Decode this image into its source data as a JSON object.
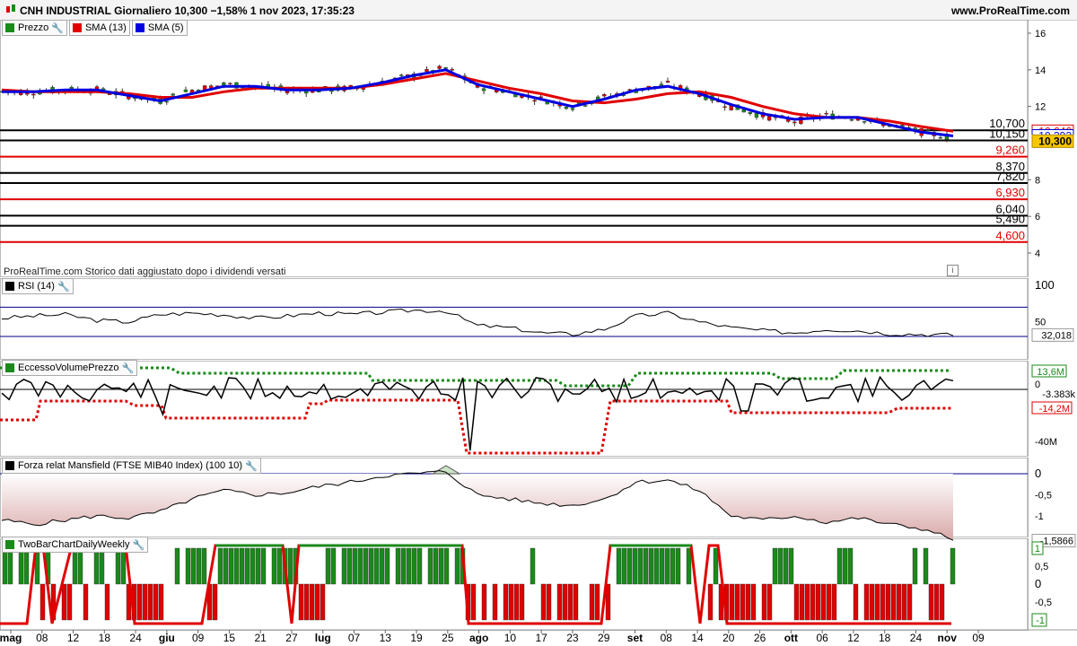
{
  "header": {
    "title": "CNH INDUSTRIAL Giornaliero 10,300 −1,58% 1 nov 2023, 17:35:23",
    "site": "www.ProRealTime.com"
  },
  "price_panel": {
    "legend": [
      {
        "label": "Prezzo",
        "color": "#1a8a1a",
        "icon": "candle-icon"
      },
      {
        "label": "SMA (13)",
        "color": "#e00000"
      },
      {
        "label": "SMA (5)",
        "color": "#0000e0"
      }
    ],
    "note": "ProRealTime.com Storico dati aggiustato dopo i dividendi versati",
    "axis_ticks": [
      "16",
      "14",
      "12",
      "8",
      "6",
      "4"
    ],
    "levels": [
      {
        "label": "10,700",
        "value": 10.7,
        "color": "#000000"
      },
      {
        "label": "10,150",
        "value": 10.15,
        "color": "#000000"
      },
      {
        "label": "9,260",
        "value": 9.26,
        "color": "#e00000"
      },
      {
        "label": "8,370",
        "value": 8.37,
        "color": "#000000"
      },
      {
        "label": "7,820",
        "value": 7.82,
        "color": "#000000"
      },
      {
        "label": "6,930",
        "value": 6.93,
        "color": "#e00000"
      },
      {
        "label": "6,040",
        "value": 6.04,
        "color": "#000000"
      },
      {
        "label": "5,490",
        "value": 5.49,
        "color": "#000000"
      },
      {
        "label": "4,600",
        "value": 4.6,
        "color": "#e00000"
      }
    ],
    "last_price": "10,300",
    "sma13_value": "10,646",
    "sma5_value": "10,392"
  },
  "rsi_panel": {
    "legend": "RSI (14)",
    "axis_ticks": [
      "100",
      "50"
    ],
    "value": "32,018"
  },
  "volume_panel": {
    "legend": "EccessoVolumePrezzo",
    "axis_ticks": [
      "0",
      "-40M"
    ],
    "upper_value": "13,6M",
    "value": "-3.383k",
    "lower_value": "-14,2M"
  },
  "mansfield_panel": {
    "legend": "Forza relat Mansfield (FTSE MIB40 Index) (100 10)",
    "axis_ticks": [
      "0",
      "-0,5",
      "-1"
    ],
    "value": "-1,5866"
  },
  "twobar_panel": {
    "legend": "TwoBarChartDailyWeekly",
    "axis_ticks": [
      "0,5",
      "0",
      "-0,5"
    ],
    "upper_value": "1",
    "lower_value": "-1"
  },
  "x_axis": {
    "labels": [
      "mag",
      "08",
      "12",
      "18",
      "24",
      "giu",
      "09",
      "15",
      "21",
      "27",
      "lug",
      "07",
      "13",
      "19",
      "25",
      "ago",
      "10",
      "17",
      "23",
      "29",
      "set",
      "08",
      "14",
      "20",
      "26",
      "ott",
      "06",
      "12",
      "18",
      "24",
      "nov",
      "09"
    ]
  },
  "colors": {
    "up": "#1a8a1a",
    "down": "#e00000",
    "sma13": "#e00000",
    "sma5": "#0000e0",
    "highlight": "#f7c600"
  },
  "chart_data": {
    "type": "line",
    "title": "CNH INDUSTRIAL Giornaliero 10,300 −1,58% 1 nov 2023, 17:35:23",
    "x": [
      "mag",
      "08",
      "12",
      "18",
      "24",
      "giu",
      "09",
      "15",
      "21",
      "27",
      "lug",
      "07",
      "13",
      "19",
      "25",
      "ago",
      "10",
      "17",
      "23",
      "29",
      "set",
      "08",
      "14",
      "20",
      "26",
      "ott",
      "06",
      "12",
      "18",
      "24",
      "nov"
    ],
    "series": [
      {
        "name": "Prezzo",
        "values": [
          12.8,
          12.8,
          12.9,
          12.9,
          12.6,
          12.3,
          12.9,
          13.2,
          13.1,
          12.9,
          12.9,
          13.0,
          13.3,
          13.7,
          14.1,
          13.1,
          12.8,
          12.4,
          12.0,
          12.5,
          12.9,
          13.2,
          12.7,
          12.0,
          11.5,
          11.2,
          11.5,
          11.4,
          11.0,
          10.6,
          10.3
        ]
      },
      {
        "name": "SMA (13)",
        "values": [
          12.9,
          12.8,
          12.8,
          12.8,
          12.7,
          12.5,
          12.5,
          12.8,
          13.0,
          13.0,
          13.0,
          13.0,
          13.2,
          13.5,
          13.8,
          13.4,
          13.0,
          12.7,
          12.3,
          12.2,
          12.4,
          12.7,
          12.8,
          12.5,
          12.0,
          11.6,
          11.4,
          11.4,
          11.2,
          10.9,
          10.646
        ]
      },
      {
        "name": "SMA (5)",
        "values": [
          12.8,
          12.8,
          12.9,
          12.9,
          12.6,
          12.3,
          12.7,
          13.1,
          13.1,
          12.9,
          12.9,
          13.0,
          13.3,
          13.7,
          14.0,
          13.2,
          12.8,
          12.4,
          12.0,
          12.4,
          12.9,
          13.1,
          12.7,
          12.1,
          11.6,
          11.3,
          11.4,
          11.4,
          11.0,
          10.6,
          10.392
        ]
      }
    ],
    "ylim": [
      3.5,
      17
    ],
    "ylabel": "",
    "xlabel": ""
  }
}
